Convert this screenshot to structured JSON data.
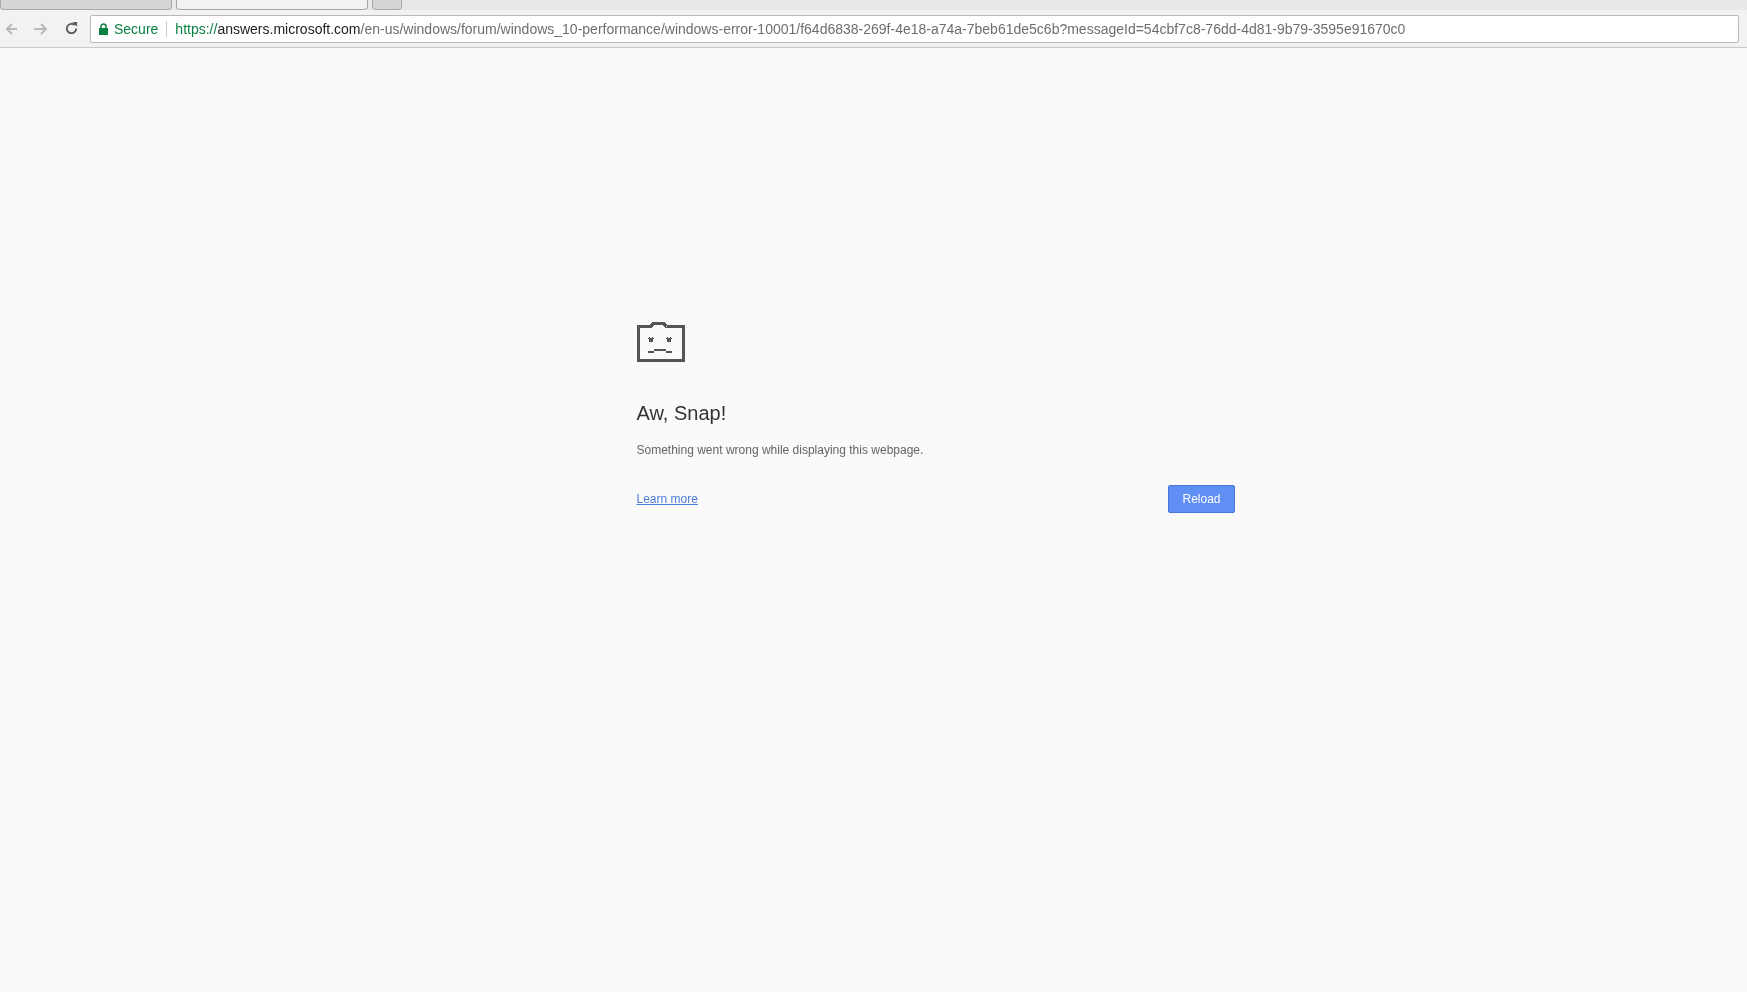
{
  "tabs": [
    {
      "selected": false
    },
    {
      "selected": true
    },
    {
      "selected": false
    }
  ],
  "toolbar": {
    "back_disabled": true,
    "forward_disabled": true
  },
  "address_bar": {
    "security_label": "Secure",
    "scheme": "https://",
    "host": "answers.microsoft.com",
    "path": "/en-us/windows/forum/windows_10-performance/windows-error-10001/f64d6838-269f-4e18-a74a-7beb61de5c6b?messageId=54cbf7c8-76dd-4d81-9b79-3595e91670c0"
  },
  "error_page": {
    "title": "Aw, Snap!",
    "message": "Something went wrong while displaying this webpage.",
    "link": "Learn more",
    "button": "Reload"
  }
}
